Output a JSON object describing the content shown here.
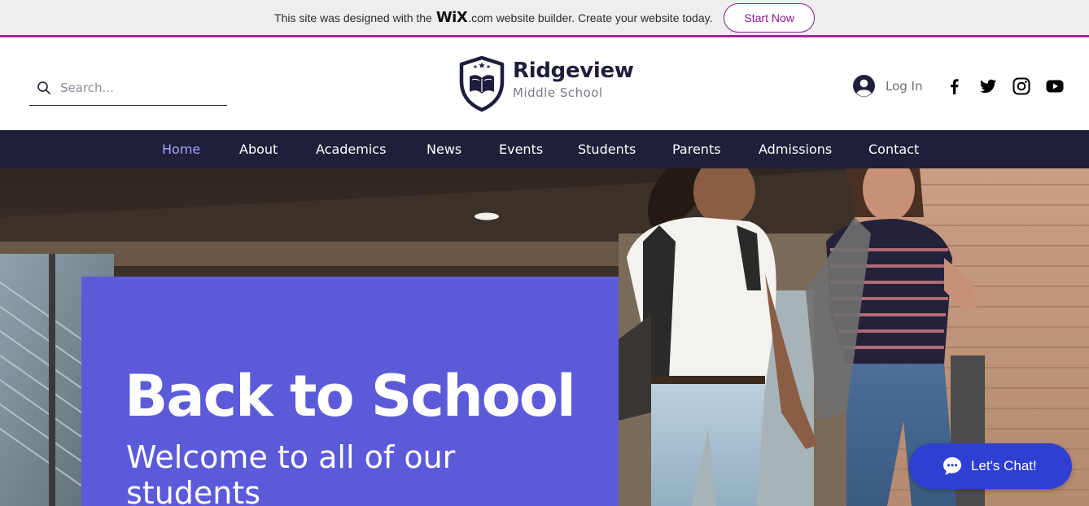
{
  "wix_banner": {
    "text_before": "This site was designed with the",
    "wix_logo": "WiX",
    "text_after_logo": ".com",
    "text_end": "website builder. Create your website today.",
    "start_button": "Start Now",
    "accent": "#a3279e"
  },
  "header": {
    "search_placeholder": "Search...",
    "logo": {
      "name": "Ridgeview",
      "subtitle": "Middle School",
      "icon": "shield-book-icon"
    },
    "login_label": "Log In",
    "social": [
      "facebook-icon",
      "twitter-icon",
      "instagram-icon",
      "youtube-icon"
    ]
  },
  "nav": {
    "items": [
      {
        "label": "Home",
        "active": true
      },
      {
        "label": "About"
      },
      {
        "label": "Academics"
      },
      {
        "label": "News"
      },
      {
        "label": "Events"
      },
      {
        "label": "Students"
      },
      {
        "label": "Parents"
      },
      {
        "label": "Admissions"
      },
      {
        "label": "Contact"
      }
    ],
    "background": "#1f1f3a",
    "active_color": "#9fa6ff"
  },
  "hero": {
    "title": "Back to School",
    "subtitle": "Welcome to all of our students",
    "card_color": "#5b5bd9"
  },
  "chat": {
    "label": "Let's Chat!",
    "color": "#2f3fd2"
  }
}
